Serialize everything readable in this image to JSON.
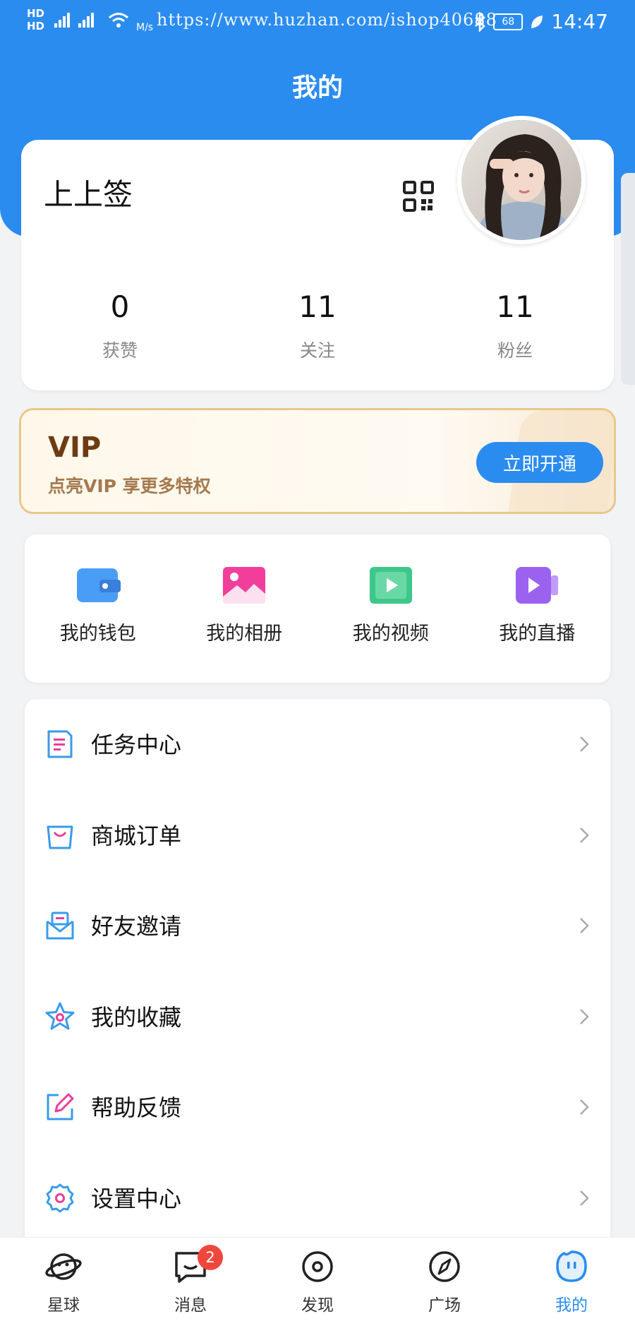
{
  "status_bar": {
    "hd_top": "HD",
    "hd_bottom": "HD",
    "network_speed": "M/s",
    "watermark": "https://www.huzhan.com/ishop40688",
    "battery": "68",
    "time": "14:47"
  },
  "header": {
    "title": "我的"
  },
  "profile": {
    "username": "上上签",
    "stats": [
      {
        "value": "0",
        "label": "获赞"
      },
      {
        "value": "11",
        "label": "关注"
      },
      {
        "value": "11",
        "label": "粉丝"
      }
    ]
  },
  "vip": {
    "title": "VIP",
    "subtitle": "点亮VIP 享更多特权",
    "button_label": "立即开通"
  },
  "quick_actions": [
    {
      "label": "我的钱包",
      "icon": "wallet-icon",
      "color": "#4a9df5"
    },
    {
      "label": "我的相册",
      "icon": "album-icon",
      "color": "#f23e9b"
    },
    {
      "label": "我的视频",
      "icon": "video-icon",
      "color": "#3dc889"
    },
    {
      "label": "我的直播",
      "icon": "live-icon",
      "color": "#9b62f0"
    }
  ],
  "menu": [
    {
      "label": "任务中心",
      "icon": "task-icon"
    },
    {
      "label": "商城订单",
      "icon": "shopping-bag-icon"
    },
    {
      "label": "好友邀请",
      "icon": "invite-mail-icon"
    },
    {
      "label": "我的收藏",
      "icon": "star-icon"
    },
    {
      "label": "帮助反馈",
      "icon": "edit-icon"
    },
    {
      "label": "设置中心",
      "icon": "gear-icon"
    }
  ],
  "tab_bar": [
    {
      "label": "星球",
      "icon": "planet-icon",
      "active": false
    },
    {
      "label": "消息",
      "icon": "message-icon",
      "active": false,
      "badge": "2"
    },
    {
      "label": "发现",
      "icon": "discover-icon",
      "active": false
    },
    {
      "label": "广场",
      "icon": "compass-icon",
      "active": false
    },
    {
      "label": "我的",
      "icon": "profile-icon",
      "active": true
    }
  ],
  "colors": {
    "primary": "#2b8cf0",
    "vip_border": "#e9c887",
    "vip_title": "#6d3b14",
    "badge": "#f0473d",
    "menu_icon_blue": "#3a9bea",
    "menu_icon_pink": "#e83f9a"
  }
}
